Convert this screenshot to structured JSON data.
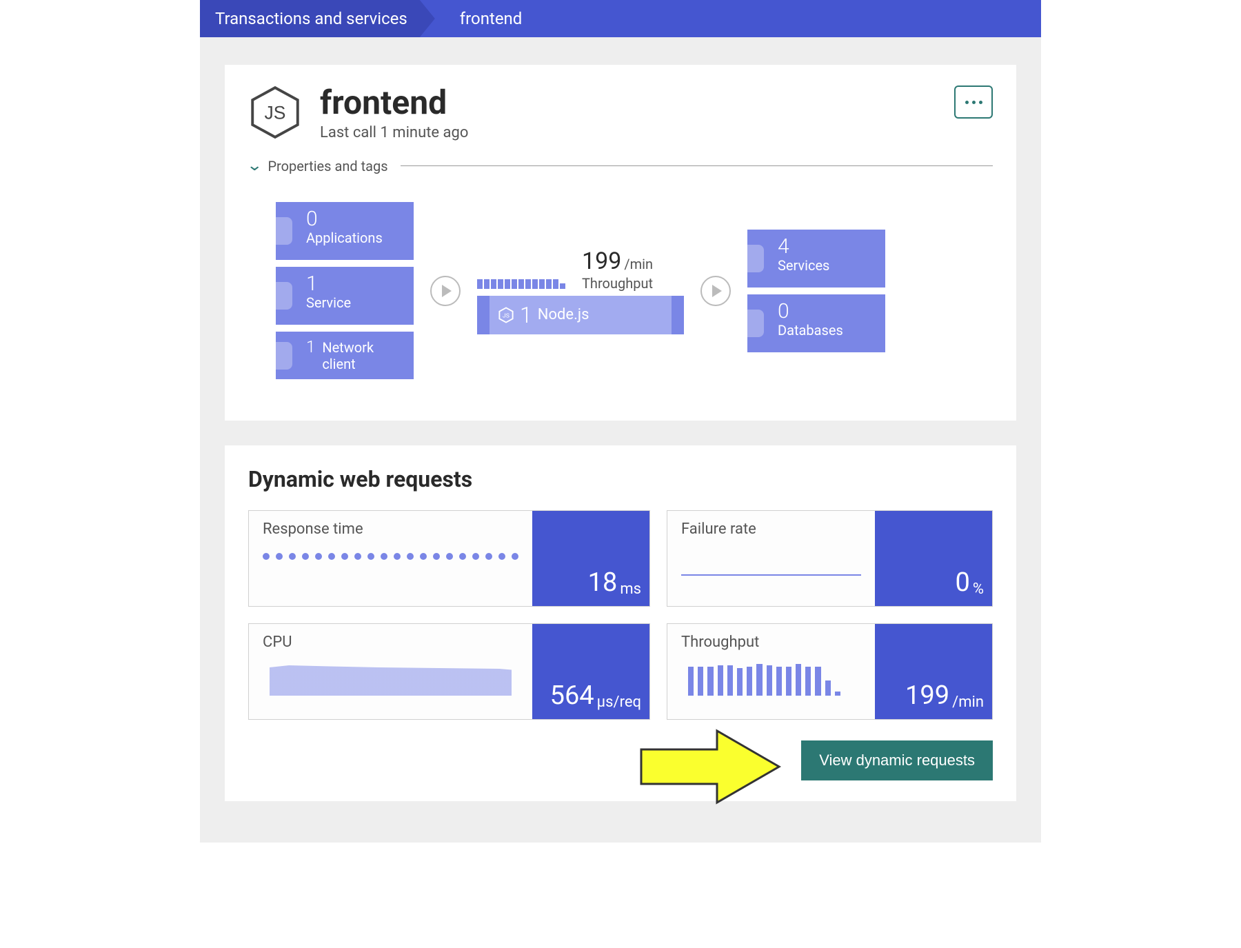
{
  "breadcrumb": {
    "root": "Transactions and services",
    "leaf": "frontend"
  },
  "header": {
    "title": "frontend",
    "subtitle": "Last call 1 minute ago",
    "properties_label": "Properties and tags"
  },
  "flow": {
    "left_tiles": [
      {
        "value": "0",
        "label": "Applications"
      },
      {
        "value": "1",
        "label": "Service"
      },
      {
        "value": "1",
        "label": "Network client",
        "compact": true
      }
    ],
    "throughput": {
      "value": "199",
      "unit": "/min",
      "label": "Throughput"
    },
    "node": {
      "count": "1",
      "tech": "Node.js"
    },
    "right_tiles": [
      {
        "value": "4",
        "label": "Services"
      },
      {
        "value": "0",
        "label": "Databases"
      }
    ]
  },
  "requests": {
    "section_title": "Dynamic web requests",
    "cta": "View dynamic requests",
    "metrics": {
      "response_time": {
        "name": "Response time",
        "value": "18",
        "unit": "ms"
      },
      "failure_rate": {
        "name": "Failure rate",
        "value": "0",
        "unit": "%"
      },
      "cpu": {
        "name": "CPU",
        "value": "564",
        "unit": "µs/req"
      },
      "throughput": {
        "name": "Throughput",
        "value": "199",
        "unit": "/min"
      }
    }
  },
  "chart_data": [
    {
      "type": "bar",
      "id": "throughput-sparkline",
      "values": [
        14,
        14,
        14,
        14,
        14,
        14,
        14,
        14,
        14,
        14,
        14,
        14,
        8
      ],
      "ylim": [
        0,
        20
      ]
    },
    {
      "type": "line",
      "id": "response-time-dots",
      "values": [
        18,
        18,
        18,
        18,
        18,
        18,
        18,
        18,
        18,
        18,
        18,
        18,
        18,
        18,
        18,
        18,
        18,
        18,
        18,
        18
      ],
      "unit": "ms"
    },
    {
      "type": "line",
      "id": "failure-rate-line",
      "values": [
        0,
        0
      ],
      "unit": "%"
    },
    {
      "type": "area",
      "id": "cpu-area",
      "values": [
        640,
        660,
        650,
        640,
        630,
        620,
        610,
        605,
        600
      ],
      "unit": "µs/req"
    },
    {
      "type": "bar",
      "id": "throughput-bars",
      "values": [
        200,
        200,
        200,
        205,
        205,
        195,
        200,
        210,
        205,
        200,
        200,
        210,
        200,
        200,
        100,
        20
      ],
      "unit": "/min"
    }
  ]
}
